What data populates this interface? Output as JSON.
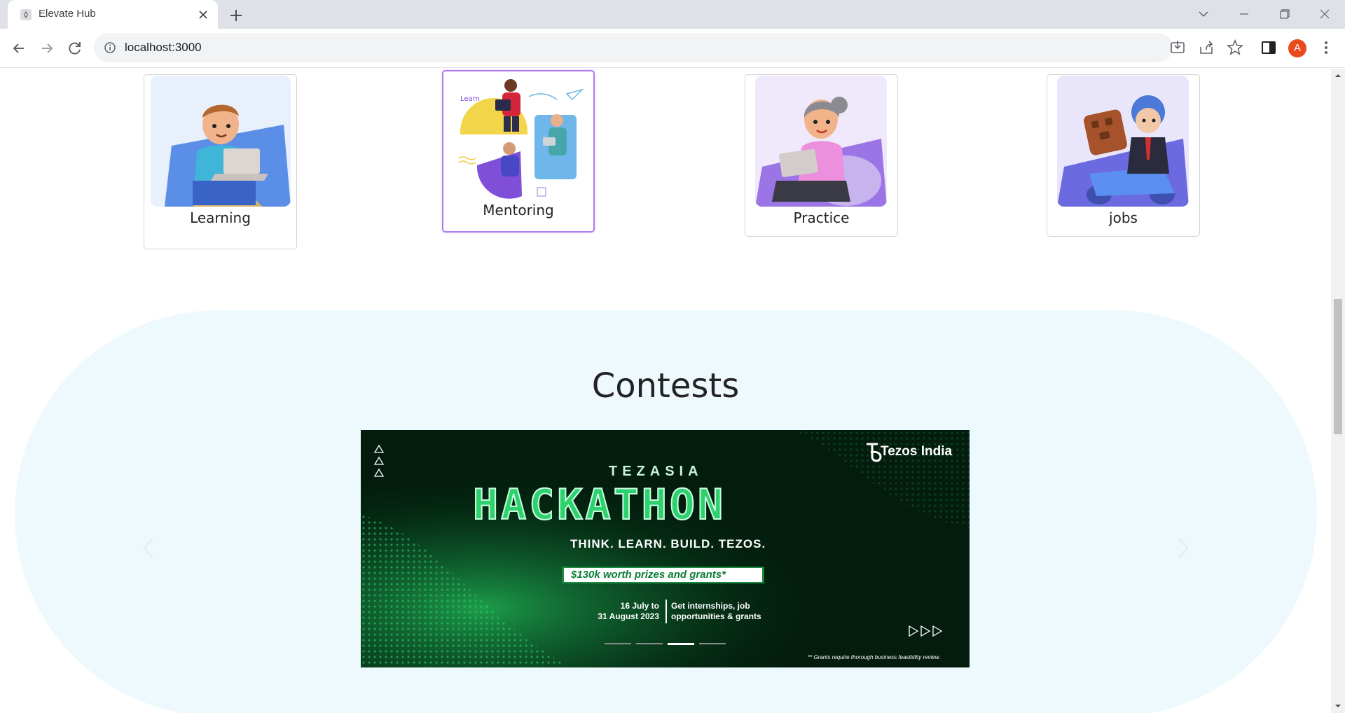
{
  "browser": {
    "tab_title": "Elevate Hub",
    "url": "localhost:3000",
    "profile_initial": "A"
  },
  "categories": [
    {
      "label": "Learning"
    },
    {
      "label": "Mentoring",
      "active": true
    },
    {
      "label": "Practice"
    },
    {
      "label": "jobs"
    }
  ],
  "mentoring_art_text": "Learn",
  "contests": {
    "title": "Contests",
    "banner": {
      "brand": "Tezos India",
      "eyebrow": "TEZASIA",
      "headline": "HACKATHON",
      "tagline": "THINK. LEARN. BUILD. TEZOS.",
      "prize": "$130k worth prizes and grants*",
      "dates_line1": "16 July to",
      "dates_line2": "31 August 2023",
      "perks_line1": "Get internships, job",
      "perks_line2": "opportunities & grants",
      "footnote": "** Grants require thorough business feasibility review.",
      "slide_count": 4,
      "active_slide": 3
    }
  },
  "colors": {
    "accent_border": "#b07ce8",
    "contest_bg": "#eef9fd",
    "banner_green": "#2fd16f",
    "avatar": "#e8491d"
  }
}
